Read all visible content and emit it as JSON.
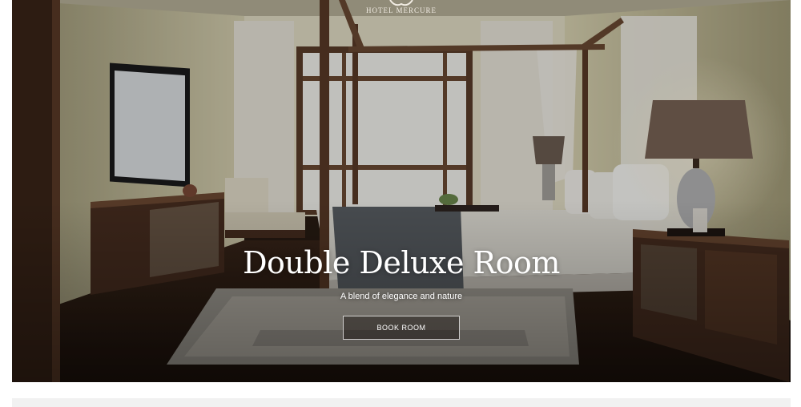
{
  "brand": {
    "name": "HOTEL MERCURE"
  },
  "hero": {
    "title": "Double Deluxe Room",
    "subtitle": "A blend of elegance and nature",
    "cta_label": "BOOK ROOM",
    "image": "bedroom-photo",
    "colors": {
      "overlay": "#000000",
      "text": "#ffffff",
      "wall": "#d8d2b2",
      "wood": "#4a2f20"
    }
  }
}
